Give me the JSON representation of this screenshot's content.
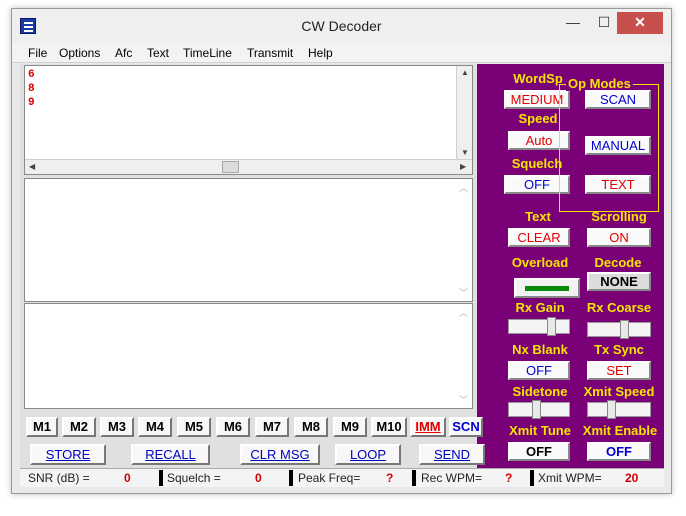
{
  "window": {
    "title": "CW Decoder",
    "controls": {
      "minimize": "—",
      "maximize": "☐",
      "close": "✕"
    }
  },
  "menu": [
    "File",
    "Options",
    "Afc",
    "Text",
    "TimeLine",
    "Transmit",
    "Help"
  ],
  "decoded_lines": [
    "6",
    "8",
    "9"
  ],
  "panel": {
    "wordsp": {
      "label": "WordSp",
      "value": "MEDIUM"
    },
    "speed": {
      "label": "Speed",
      "value": "Auto"
    },
    "squelch": {
      "label": "Squelch",
      "value": "OFF"
    },
    "op_modes": {
      "label": "Op Modes",
      "scan": "SCAN",
      "manual": "MANUAL",
      "text": "TEXT"
    },
    "text": {
      "label": "Text",
      "value": "CLEAR"
    },
    "scrolling": {
      "label": "Scrolling",
      "value": "ON"
    },
    "overload": {
      "label": "Overload"
    },
    "decode": {
      "label": "Decode",
      "value": "NONE"
    },
    "rx_gain": {
      "label": "Rx Gain",
      "level": 0.75
    },
    "rx_coarse": {
      "label": "Rx Coarse",
      "level": 0.6
    },
    "nx_blank": {
      "label": "Nx Blank",
      "value": "OFF"
    },
    "tx_sync": {
      "label": "Tx Sync",
      "value": "SET"
    },
    "sidetone": {
      "label": "Sidetone",
      "level": 0.45
    },
    "xmit_speed": {
      "label": "Xmit Speed",
      "level": 0.35
    },
    "xmit_tune": {
      "label": "Xmit Tune",
      "value": "OFF"
    },
    "xmit_enable": {
      "label": "Xmit Enable",
      "value": "OFF"
    }
  },
  "memories": [
    "M1",
    "M2",
    "M3",
    "M4",
    "M5",
    "M6",
    "M7",
    "M8",
    "M9",
    "M10"
  ],
  "imm": "IMM",
  "scn": "SCN",
  "actions": {
    "store": "STORE",
    "recall": "RECALL",
    "clr_msg": "CLR MSG",
    "loop": "LOOP",
    "send": "SEND"
  },
  "status": {
    "snr": {
      "label": "SNR (dB) =",
      "value": "0"
    },
    "squelch": {
      "label": "Squelch =",
      "value": "0"
    },
    "peak_freq": {
      "label": "Peak Freq=",
      "value": "?"
    },
    "rec_wpm": {
      "label": "Rec WPM=",
      "value": "?"
    },
    "xmit_wpm": {
      "label": "Xmit WPM=",
      "value": "20"
    }
  }
}
